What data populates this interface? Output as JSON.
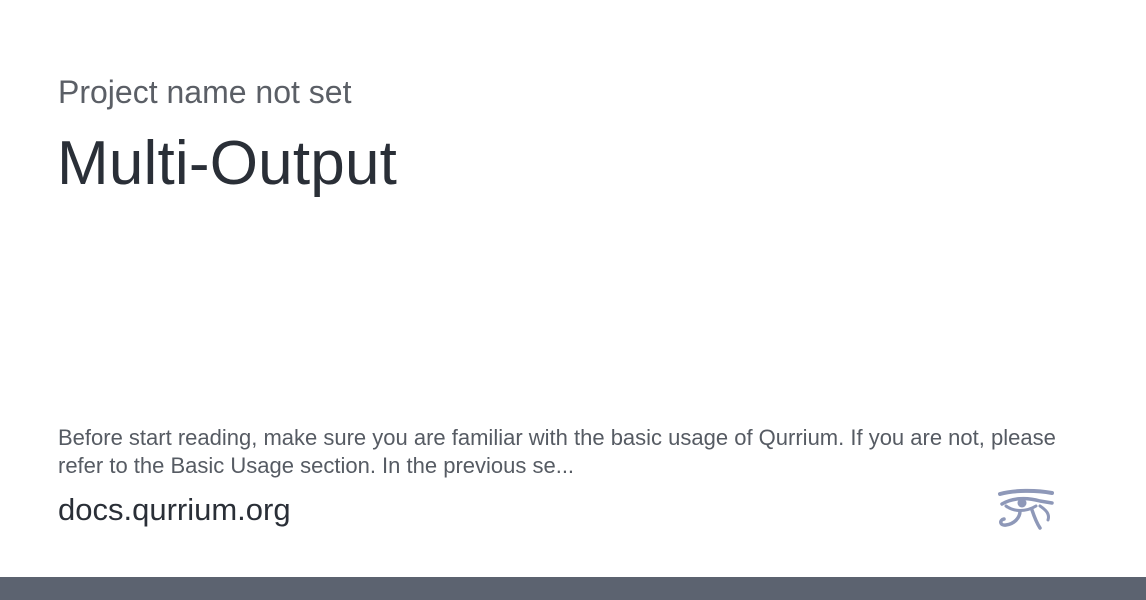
{
  "card": {
    "project_name": "Project name not set",
    "title": "Multi-Output",
    "description": "Before start reading, make sure you are familiar with the basic usage of Qurrium. If you are not, please refer to the Basic Usage section. In the previous se...",
    "site_url": "docs.qurrium.org"
  },
  "logo": {
    "icon": "eye-of-horus-icon",
    "color": "#8e98b8"
  },
  "colors": {
    "background": "#ffffff",
    "title_text": "#2a2f37",
    "secondary_text": "#5b5f66",
    "footer_bar": "#5c6370"
  }
}
